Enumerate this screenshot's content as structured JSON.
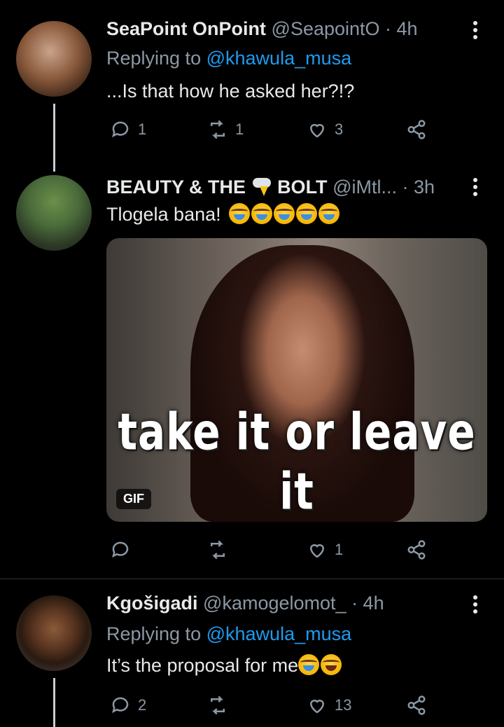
{
  "tweets": [
    {
      "name": "SeaPoint OnPoint",
      "handle": "@SeapointO",
      "time": "· 4h",
      "reply_prefix": "Replying to",
      "reply_mention": "@khawula_musa",
      "text": "...Is that how he asked her?!?",
      "replies": "1",
      "retweets": "1",
      "likes": "3"
    },
    {
      "name_part1": "BEAUTY & THE",
      "name_part2": "BOLT",
      "handle": "@iMtl...",
      "time": "· 3h",
      "text": "Tlogela bana!",
      "gif_caption": "take it or leave it",
      "gif_badge": "GIF",
      "replies": "",
      "retweets": "",
      "likes": "1"
    },
    {
      "name": "Kgošigadi",
      "handle": "@kamogelomot_",
      "time": "· 4h",
      "reply_prefix": "Replying to",
      "reply_mention": "@khawula_musa",
      "text": "It’s the proposal for me",
      "replies": "2",
      "retweets": "",
      "likes": "13"
    }
  ],
  "icons": {
    "reply": "reply-icon",
    "retweet": "retweet-icon",
    "like": "heart-icon",
    "share": "share-icon",
    "more": "more-options-icon"
  },
  "colors": {
    "background": "#000000",
    "text": "#e7e9ea",
    "muted": "#8b98a5",
    "link": "#1d9bf0"
  }
}
